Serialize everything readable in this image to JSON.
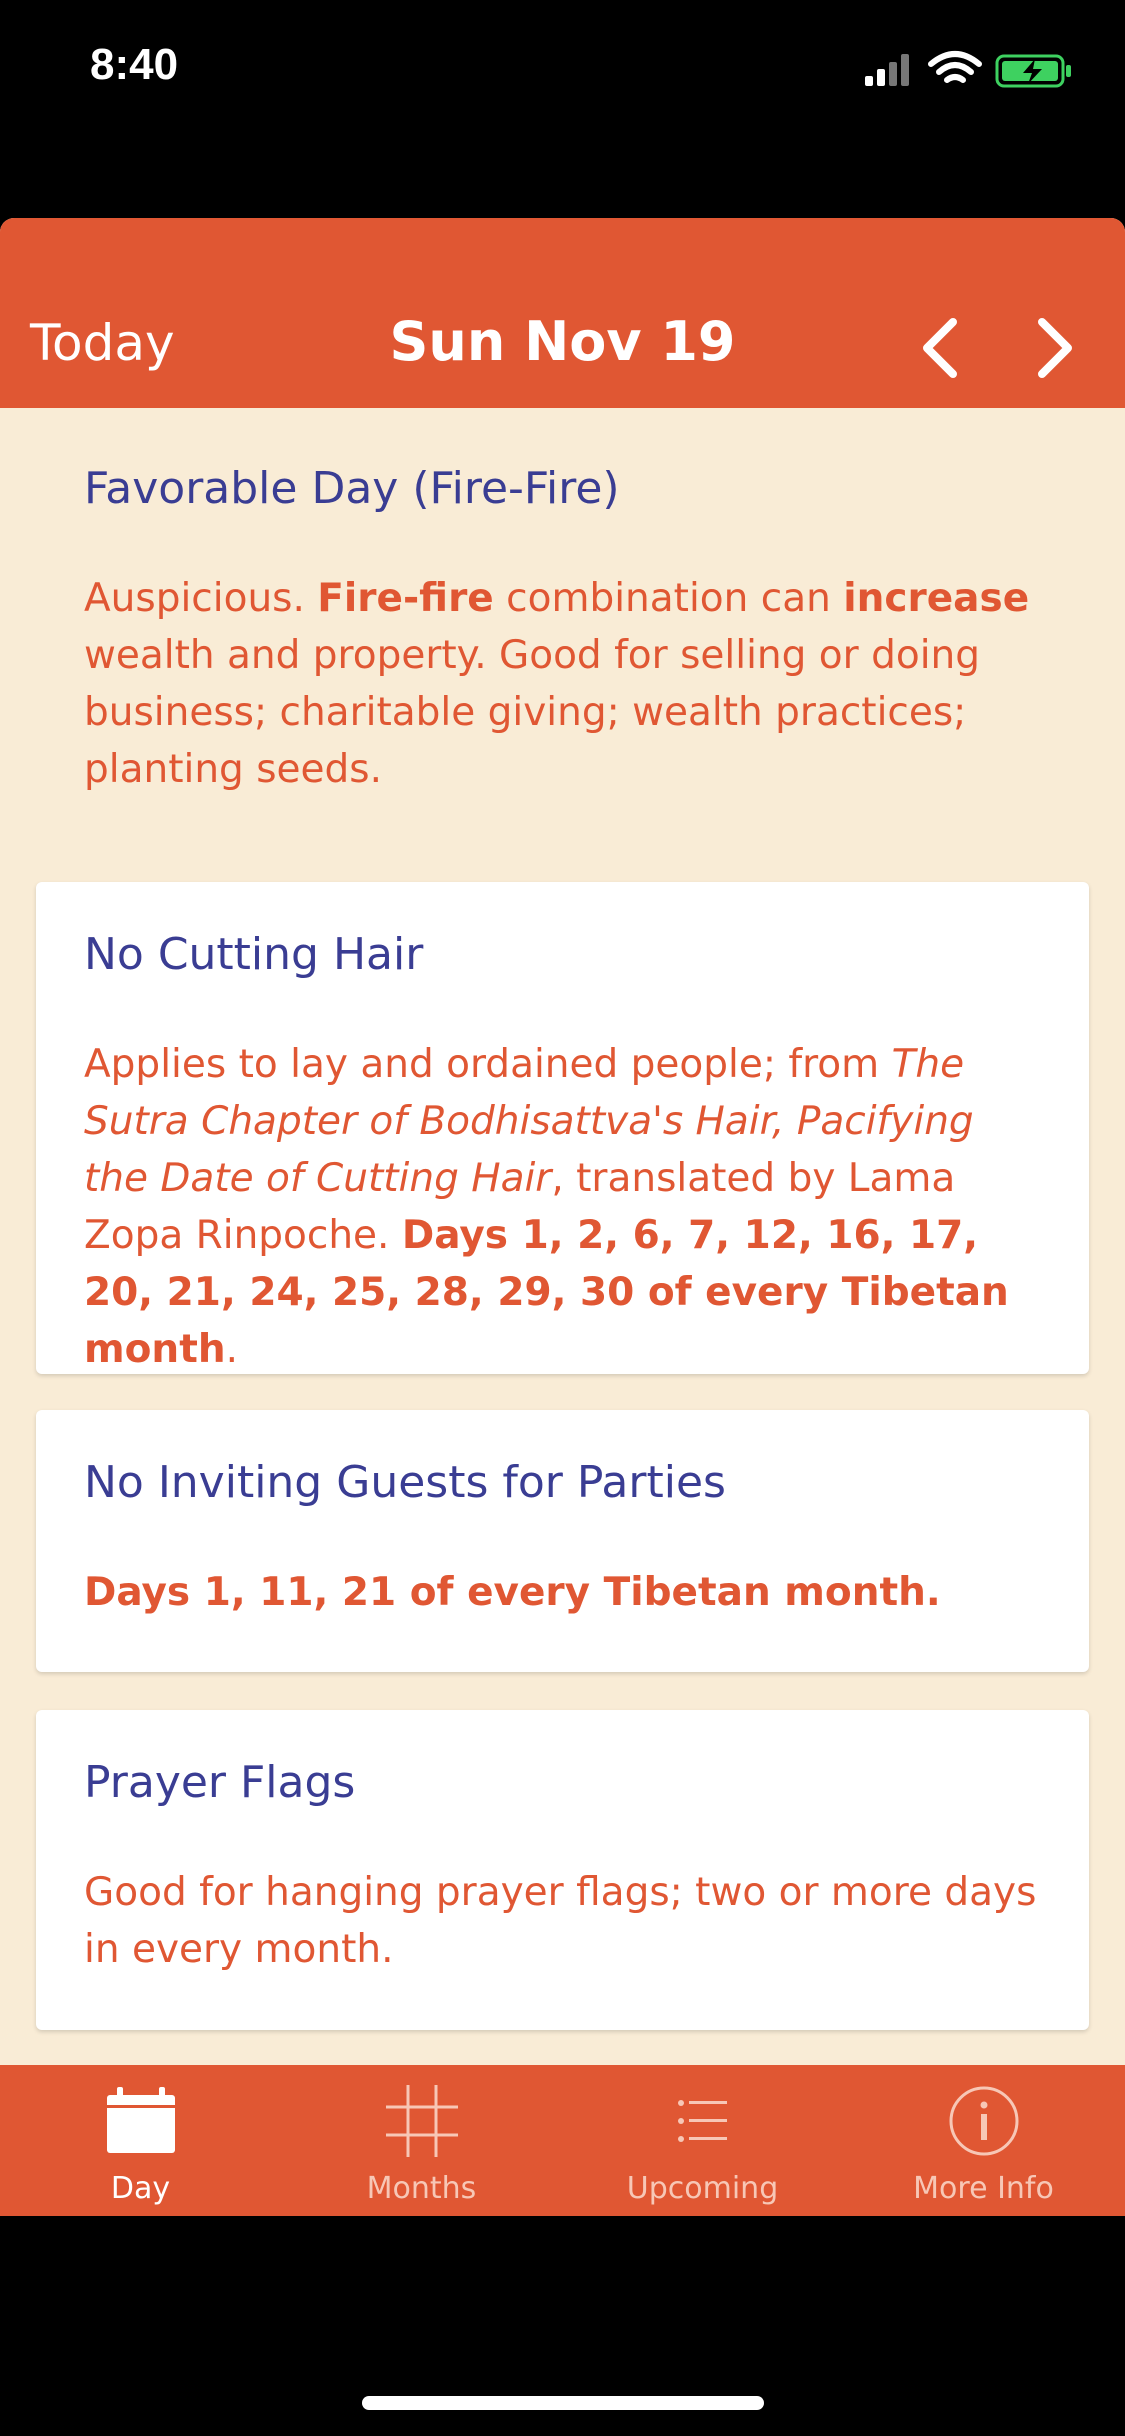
{
  "status": {
    "time": "8:40"
  },
  "nav": {
    "today": "Today",
    "title": "Sun Nov 19"
  },
  "favorable": {
    "title": "Favorable Day (Fire-Fire)",
    "body_1": "Auspicious. ",
    "body_bold_1": "Fire-fire",
    "body_2": " combination can ",
    "body_bold_2": "increase",
    "body_3": " wealth and property. Good for selling or doing business; charitable giving; wealth practices; planting seeds."
  },
  "cards": [
    {
      "title": "No Cutting Hair",
      "body_1": "Applies to lay and ordained people; from ",
      "body_italic_1": "The Sutra Chapter of Bodhisattva's Hair, Pacifying the Date of Cutting Hair",
      "body_2": ", translated by Lama Zopa Rinpoche. ",
      "body_bold": "Days 1, 2, 6, 7, 12, 16, 17, 20, 21, 24, 25, 28, 29, 30 of every Tibetan month",
      "body_3": "."
    },
    {
      "title": "No Inviting Guests for Parties",
      "body_bold": "Days 1, 11, 21 of every Tibetan month."
    },
    {
      "title": "Prayer Flags",
      "body": "Good for hanging prayer flags; two or more days in every month."
    }
  ],
  "tabs": [
    {
      "label": "Day",
      "icon": "calendar-icon",
      "active": true
    },
    {
      "label": "Months",
      "icon": "grid-icon",
      "active": false
    },
    {
      "label": "Upcoming",
      "icon": "list-icon",
      "active": false
    },
    {
      "label": "More Info",
      "icon": "info-icon",
      "active": false
    }
  ],
  "colors": {
    "accent": "#e05733",
    "title": "#3a3d93",
    "background": "#f9ecd6"
  }
}
